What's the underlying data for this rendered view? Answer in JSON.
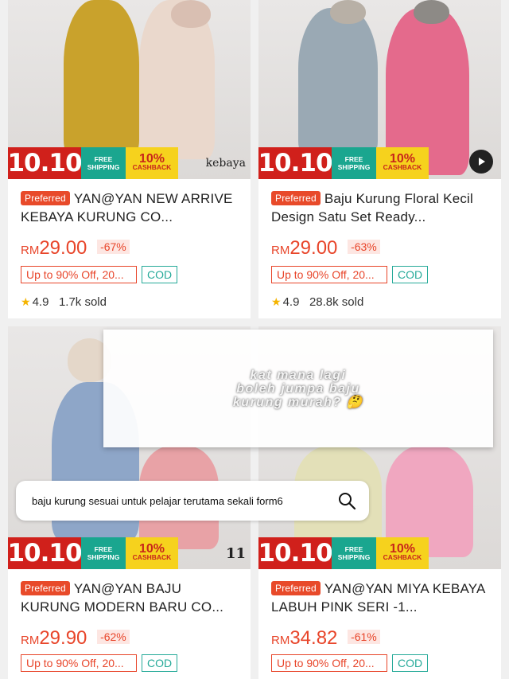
{
  "products": [
    {
      "banner": {
        "sale": "10.10",
        "free1": "FREE",
        "free2": "SHIPPING",
        "cash_pct": "10%",
        "cash_label": "CASHBACK",
        "tag": "kebaya"
      },
      "preferred": "Preferred",
      "title": "YAN@YAN NEW ARRIVE KEBAYA KURUNG CO...",
      "price_currency": "RM",
      "price_value": "29.00",
      "discount": "-67%",
      "voucher": "Up to 90% Off, 20...",
      "cod": "COD",
      "rating": "4.9",
      "sold": "1.7k sold"
    },
    {
      "banner": {
        "sale": "10.10",
        "free1": "FREE",
        "free2": "SHIPPING",
        "cash_pct": "10%",
        "cash_label": "CASHBACK",
        "tag": ""
      },
      "preferred": "Preferred",
      "title": "Baju Kurung Floral Kecil Design Satu Set Ready...",
      "price_currency": "RM",
      "price_value": "29.00",
      "discount": "-63%",
      "voucher": "Up to 90% Off, 20...",
      "cod": "COD",
      "rating": "4.9",
      "sold": "28.8k sold"
    },
    {
      "banner": {
        "sale": "10.10",
        "free1": "FREE",
        "free2": "SHIPPING",
        "cash_pct": "10%",
        "cash_label": "CASHBACK",
        "tag": "11"
      },
      "preferred": "Preferred",
      "title": "YAN@YAN BAJU KURUNG MODERN BARU CO...",
      "price_currency": "RM",
      "price_value": "29.90",
      "discount": "-62%",
      "voucher": "Up to 90% Off, 20...",
      "cod": "COD"
    },
    {
      "banner": {
        "sale": "10.10",
        "free1": "FREE",
        "free2": "SHIPPING",
        "cash_pct": "10%",
        "cash_label": "CASHBACK",
        "tag": ""
      },
      "preferred": "Preferred",
      "title": "YAN@YAN MIYA KEBAYA LABUH  PINK SERI -1...",
      "price_currency": "RM",
      "price_value": "34.82",
      "discount": "-61%",
      "voucher": "Up to 90% Off, 20...",
      "cod": "COD"
    }
  ],
  "overlay": {
    "line1": "kat mana lagi",
    "line2": "boleh jumpa baju",
    "line3": "kurung murah? 🤔"
  },
  "search": {
    "query": "baju kurung sesuai untuk pelajar terutama sekali form6",
    "icon": "search-icon"
  },
  "colors": {
    "price": "#e8452a",
    "sale_red": "#d0201b",
    "shipping_teal": "#1aa68f",
    "cashback_yellow": "#f6d21d",
    "cod_teal": "#26aa99"
  }
}
